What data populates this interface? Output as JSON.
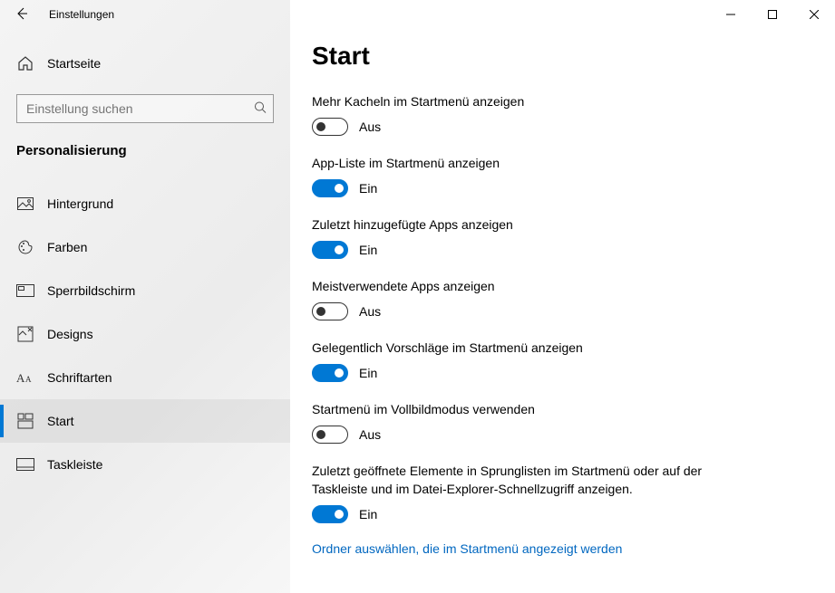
{
  "window": {
    "title": "Einstellungen"
  },
  "sidebar": {
    "home_label": "Startseite",
    "search_placeholder": "Einstellung suchen",
    "section_header": "Personalisierung",
    "items": [
      {
        "label": "Hintergrund"
      },
      {
        "label": "Farben"
      },
      {
        "label": "Sperrbildschirm"
      },
      {
        "label": "Designs"
      },
      {
        "label": "Schriftarten"
      },
      {
        "label": "Start"
      },
      {
        "label": "Taskleiste"
      }
    ]
  },
  "main": {
    "title": "Start",
    "state_on": "Ein",
    "state_off": "Aus",
    "settings": [
      {
        "label": "Mehr Kacheln im Startmenü anzeigen",
        "on": false
      },
      {
        "label": "App-Liste im Startmenü anzeigen",
        "on": true
      },
      {
        "label": "Zuletzt hinzugefügte Apps anzeigen",
        "on": true
      },
      {
        "label": "Meistverwendete Apps anzeigen",
        "on": false
      },
      {
        "label": "Gelegentlich Vorschläge im Startmenü anzeigen",
        "on": true
      },
      {
        "label": "Startmenü im Vollbildmodus verwenden",
        "on": false
      },
      {
        "label": "Zuletzt geöffnete Elemente in Sprunglisten im Startmenü oder auf der Taskleiste und im Datei-Explorer-Schnellzugriff anzeigen.",
        "on": true
      }
    ],
    "link_text": "Ordner auswählen, die im Startmenü angezeigt werden"
  }
}
